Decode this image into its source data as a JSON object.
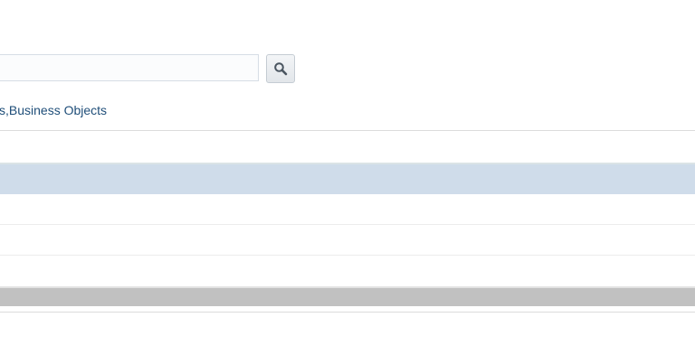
{
  "search": {
    "value": "",
    "placeholder": ""
  },
  "icons": {
    "search_button_icon": "search-icon"
  },
  "breadcrumb": {
    "clipped_prefix": "s",
    "text": ",Business Objects"
  },
  "table": {
    "rows": [
      {
        "state": "selected",
        "text": ""
      },
      {
        "state": "normal",
        "text": ""
      },
      {
        "state": "normal",
        "text": ""
      },
      {
        "state": "normal",
        "text": ""
      }
    ]
  },
  "colors": {
    "selected_row": "#cfdcea",
    "footer_bar": "#c1c1c1",
    "link_text": "#1f4e79"
  }
}
